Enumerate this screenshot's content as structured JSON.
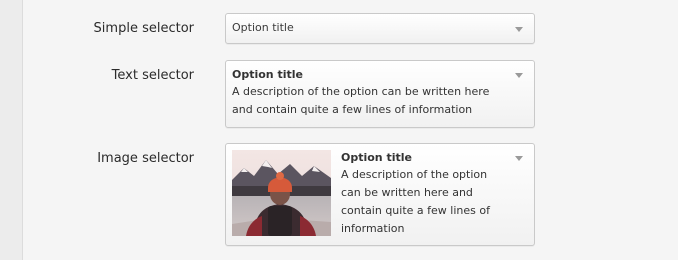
{
  "rows": {
    "simple": {
      "label": "Simple selector",
      "value": "Option title"
    },
    "text": {
      "label": "Text selector",
      "title": "Option title",
      "description": "A description of the option can be written here and contain quite a few lines of information"
    },
    "image": {
      "label": "Image selector",
      "title": "Option title",
      "description": "A description of the option can be written here and contain quite a few lines of information",
      "image_icon": "mountain-lake-photo"
    }
  },
  "colors": {
    "background": "#f5f5f5",
    "border": "#c9c9c9",
    "text": "#333333",
    "caret": "#9a9a9a"
  }
}
